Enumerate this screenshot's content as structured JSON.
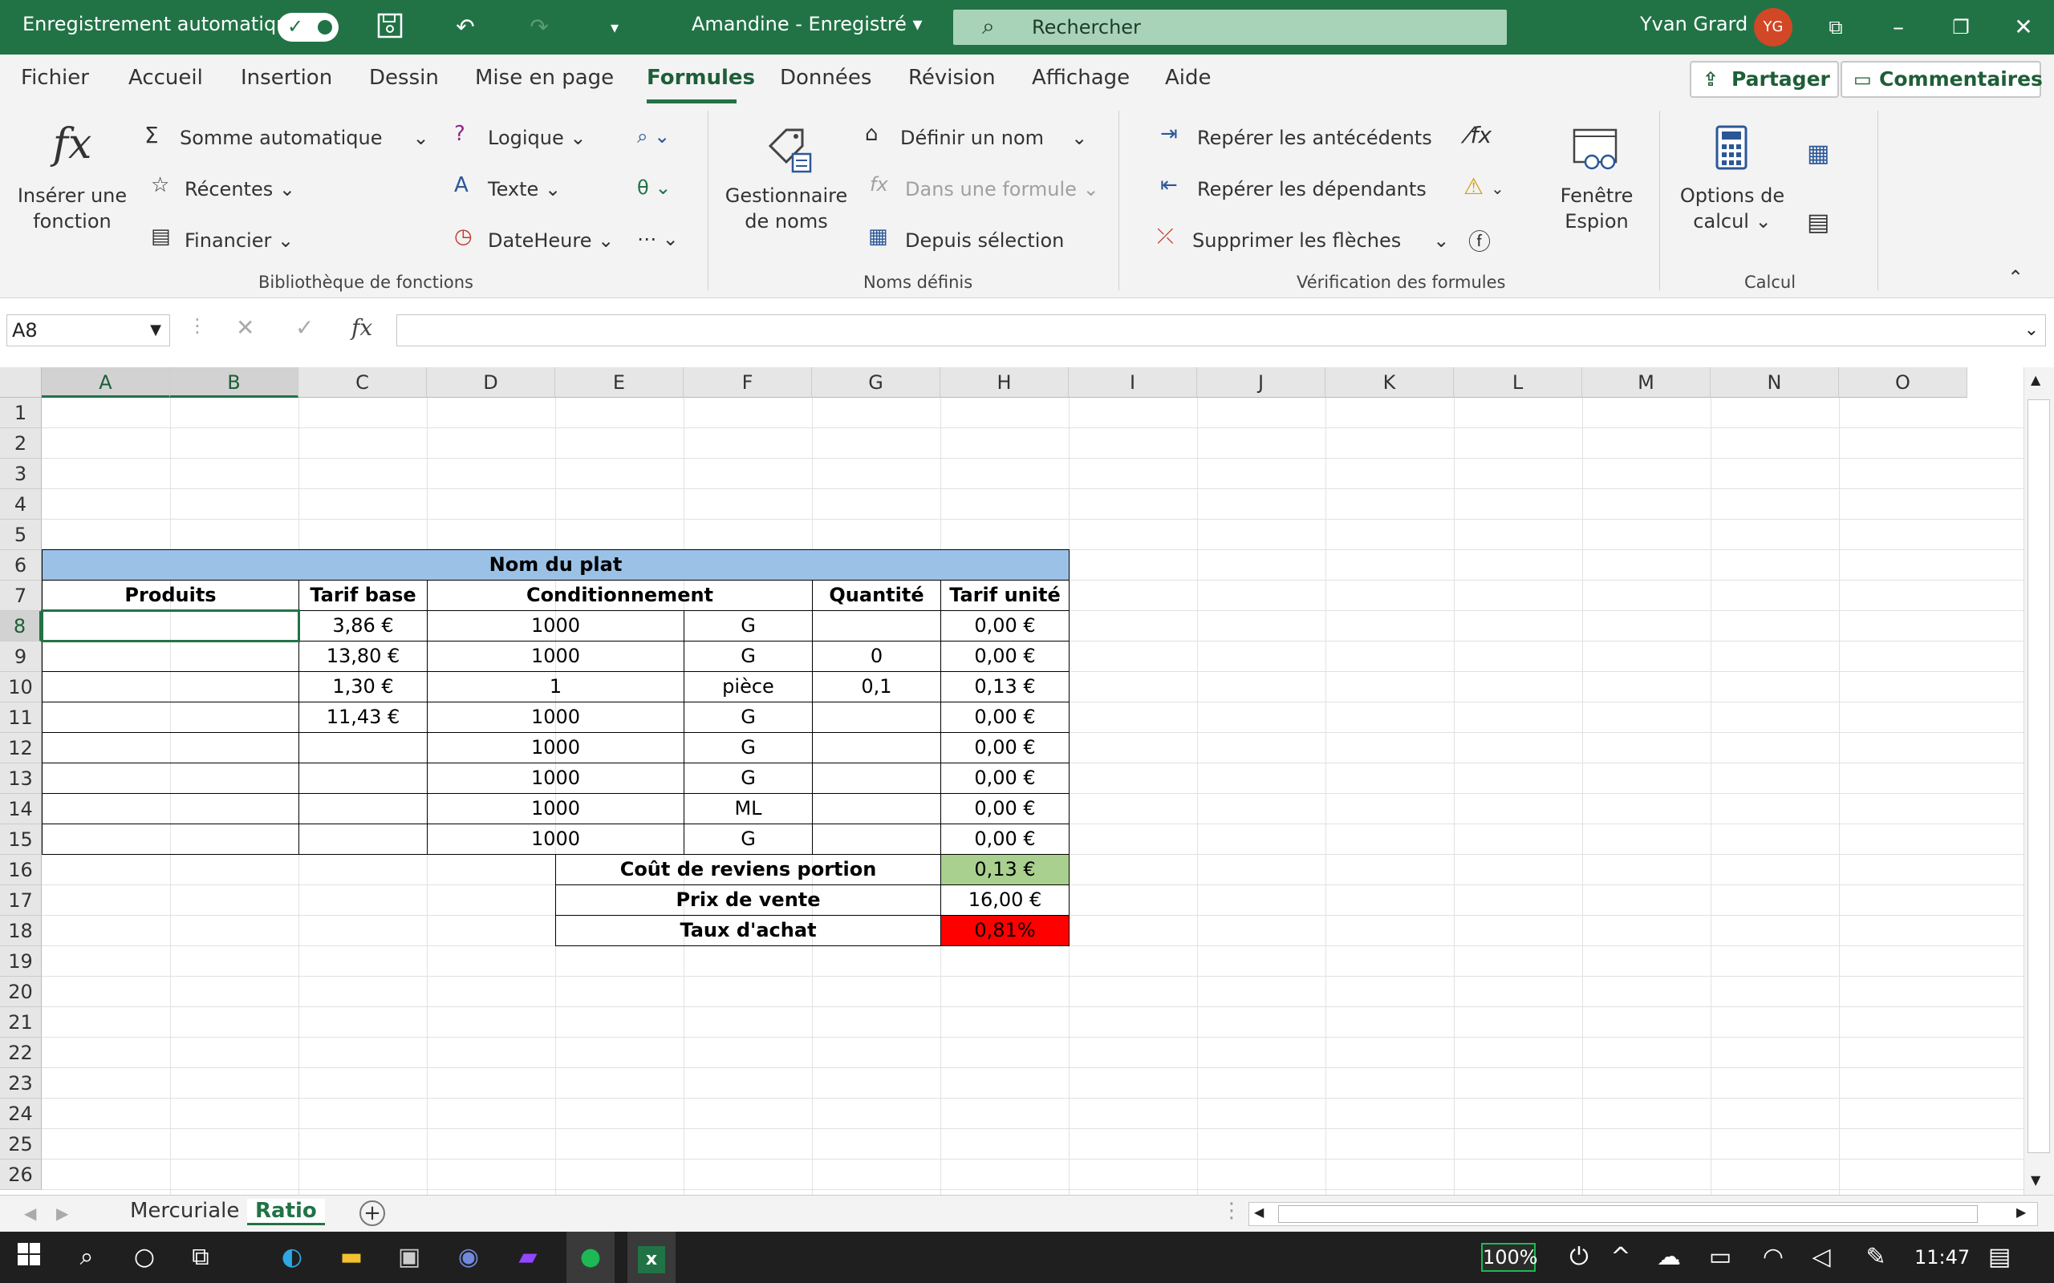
{
  "titlebar": {
    "autosave_label": "Enregistrement automatique",
    "doc_title": "Amandine  -  Enregistré",
    "search_placeholder": "Rechercher",
    "user_name": "Yvan Grard",
    "user_initials": "YG"
  },
  "menu": {
    "tabs": [
      "Fichier",
      "Accueil",
      "Insertion",
      "Dessin",
      "Mise en page",
      "Formules",
      "Données",
      "Révision",
      "Affichage",
      "Aide"
    ],
    "active_tab": "Formules",
    "share_label": "Partager",
    "comments_label": "Commentaires"
  },
  "ribbon": {
    "insert_function_line1": "Insérer une",
    "insert_function_line2": "fonction",
    "autosum": "Somme automatique",
    "recent": "Récentes",
    "financial": "Financier",
    "logical": "Logique",
    "text": "Texte",
    "datetime": "DateHeure",
    "group_library": "Bibliothèque de fonctions",
    "name_manager_line1": "Gestionnaire",
    "name_manager_line2": "de noms",
    "define_name": "Définir un nom",
    "use_in_formula": "Dans une formule",
    "create_from_selection": "Depuis sélection",
    "group_names": "Noms définis",
    "trace_precedents": "Repérer les antécédents",
    "trace_dependents": "Repérer les dépendants",
    "remove_arrows": "Supprimer les flèches",
    "watch_window_line1": "Fenêtre",
    "watch_window_line2": "Espion",
    "group_auditing": "Vérification des formules",
    "calc_options_line1": "Options de",
    "calc_options_line2": "calcul",
    "group_calc": "Calcul"
  },
  "formula_bar": {
    "name_box": "A8",
    "fx_label": "fx",
    "formula": ""
  },
  "grid": {
    "columns": [
      "A",
      "B",
      "C",
      "D",
      "E",
      "F",
      "G",
      "H",
      "I",
      "J",
      "K",
      "L",
      "M",
      "N",
      "O"
    ],
    "rows": [
      "1",
      "2",
      "3",
      "4",
      "5",
      "6",
      "7",
      "8",
      "9",
      "10",
      "11",
      "12",
      "13",
      "14",
      "15",
      "16",
      "17",
      "18",
      "19",
      "20",
      "21",
      "22",
      "23",
      "24",
      "25",
      "26"
    ],
    "selected_cell": "A8",
    "table_title": "Nom du plat",
    "headers": {
      "products": "Produits",
      "base_price": "Tarif base",
      "packaging": "Conditionnement",
      "quantity": "Quantité",
      "unit_price": "Tarif unité"
    },
    "table_rows": [
      {
        "product": "",
        "base_price": "3,86 €",
        "pack_qty": "1000",
        "unit": "G",
        "quantity": "",
        "unit_price": "0,00 €"
      },
      {
        "product": "",
        "base_price": "13,80 €",
        "pack_qty": "1000",
        "unit": "G",
        "quantity": "0",
        "unit_price": "0,00 €"
      },
      {
        "product": "",
        "base_price": "1,30 €",
        "pack_qty": "1",
        "unit": "pièce",
        "quantity": "0,1",
        "unit_price": "0,13 €"
      },
      {
        "product": "",
        "base_price": "11,43 €",
        "pack_qty": "1000",
        "unit": "G",
        "quantity": "",
        "unit_price": "0,00 €"
      },
      {
        "product": "",
        "base_price": "",
        "pack_qty": "1000",
        "unit": "G",
        "quantity": "",
        "unit_price": "0,00 €"
      },
      {
        "product": "",
        "base_price": "",
        "pack_qty": "1000",
        "unit": "G",
        "quantity": "",
        "unit_price": "0,00 €"
      },
      {
        "product": "",
        "base_price": "",
        "pack_qty": "1000",
        "unit": "ML",
        "quantity": "",
        "unit_price": "0,00 €"
      },
      {
        "product": "",
        "base_price": "",
        "pack_qty": "1000",
        "unit": "G",
        "quantity": "",
        "unit_price": "0,00 €"
      }
    ],
    "summary": [
      {
        "label": "Coût de reviens portion",
        "value": "0,13 €",
        "color": "#a9d08e"
      },
      {
        "label": "Prix de vente",
        "value": "16,00 €",
        "color": "#ffffff"
      },
      {
        "label": "Taux d'achat",
        "value": "0,81%",
        "color": "#ff0000"
      }
    ],
    "title_fill": "#9bc2e6"
  },
  "sheets": {
    "tabs": [
      "Mercuriale",
      "Ratio"
    ],
    "active": "Ratio"
  },
  "taskbar": {
    "zoom": "100%",
    "time": "11:47"
  },
  "colors": {
    "excel_green": "#217346"
  }
}
